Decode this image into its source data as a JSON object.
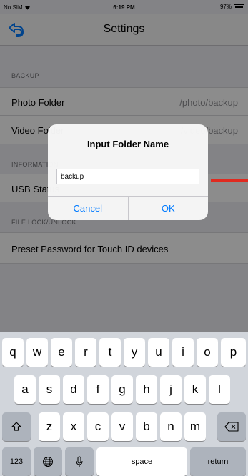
{
  "status_bar": {
    "carrier": "No SIM",
    "time": "6:19 PM",
    "battery": "97%"
  },
  "nav": {
    "title": "Settings",
    "back_icon": "back-arrow-icon"
  },
  "sections": {
    "backup": {
      "header": "BACKUP",
      "rows": [
        {
          "label": "Photo Folder",
          "value": "/photo/backup"
        },
        {
          "label": "Video Folder",
          "value": "/video/backup"
        }
      ]
    },
    "information": {
      "header": "INFORMATION",
      "rows": [
        {
          "label": "USB Status",
          "value": ""
        }
      ]
    },
    "file_lock": {
      "header": "FILE LOCK/UNLOCK",
      "rows": [
        {
          "label": "Preset Password for Touch ID devices"
        }
      ]
    }
  },
  "alert": {
    "title": "Input Folder Name",
    "input_value": "backup",
    "cancel_label": "Cancel",
    "ok_label": "OK"
  },
  "keyboard": {
    "row1": [
      "q",
      "w",
      "e",
      "r",
      "t",
      "y",
      "u",
      "i",
      "o",
      "p"
    ],
    "row2": [
      "a",
      "s",
      "d",
      "f",
      "g",
      "h",
      "j",
      "k",
      "l"
    ],
    "row3": [
      "z",
      "x",
      "c",
      "v",
      "b",
      "n",
      "m"
    ],
    "numbers_label": "123",
    "space_label": "space",
    "return_label": "return"
  },
  "colors": {
    "accent": "#007aff",
    "annotation": "#e02a1f"
  }
}
